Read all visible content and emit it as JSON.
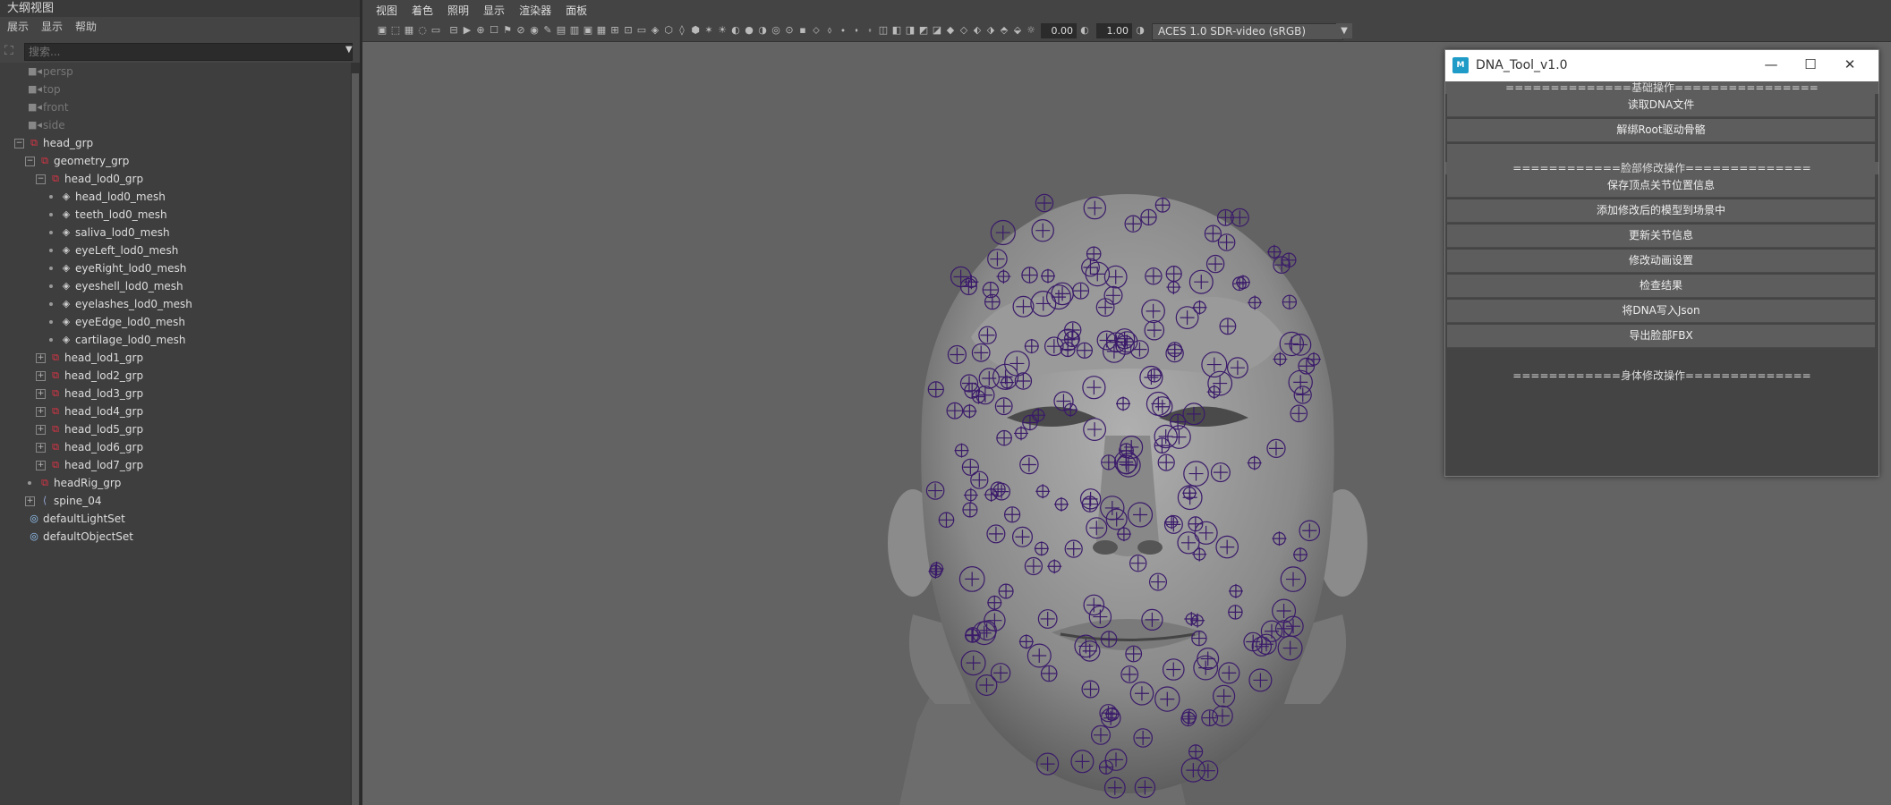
{
  "outliner": {
    "title": "大纲视图",
    "menu": [
      "展示",
      "显示",
      "帮助"
    ],
    "search_placeholder": "搜索...",
    "items": [
      {
        "label": "persp",
        "type": "camera"
      },
      {
        "label": "top",
        "type": "camera"
      },
      {
        "label": "front",
        "type": "camera"
      },
      {
        "label": "side",
        "type": "camera"
      },
      {
        "label": "head_grp",
        "type": "group"
      },
      {
        "label": "geometry_grp",
        "type": "group"
      },
      {
        "label": "head_lod0_grp",
        "type": "group"
      },
      {
        "label": "head_lod0_mesh",
        "type": "mesh"
      },
      {
        "label": "teeth_lod0_mesh",
        "type": "mesh"
      },
      {
        "label": "saliva_lod0_mesh",
        "type": "mesh"
      },
      {
        "label": "eyeLeft_lod0_mesh",
        "type": "mesh"
      },
      {
        "label": "eyeRight_lod0_mesh",
        "type": "mesh"
      },
      {
        "label": "eyeshell_lod0_mesh",
        "type": "mesh"
      },
      {
        "label": "eyelashes_lod0_mesh",
        "type": "mesh"
      },
      {
        "label": "eyeEdge_lod0_mesh",
        "type": "mesh"
      },
      {
        "label": "cartilage_lod0_mesh",
        "type": "mesh"
      },
      {
        "label": "head_lod1_grp",
        "type": "group"
      },
      {
        "label": "head_lod2_grp",
        "type": "group"
      },
      {
        "label": "head_lod3_grp",
        "type": "group"
      },
      {
        "label": "head_lod4_grp",
        "type": "group"
      },
      {
        "label": "head_lod5_grp",
        "type": "group"
      },
      {
        "label": "head_lod6_grp",
        "type": "group"
      },
      {
        "label": "head_lod7_grp",
        "type": "group"
      },
      {
        "label": "headRig_grp",
        "type": "group"
      },
      {
        "label": "spine_04",
        "type": "joint"
      },
      {
        "label": "defaultLightSet",
        "type": "set"
      },
      {
        "label": "defaultObjectSet",
        "type": "set"
      }
    ]
  },
  "viewport": {
    "menu": [
      "视图",
      "着色",
      "照明",
      "显示",
      "渲染器",
      "面板"
    ],
    "exposure": "0.00",
    "gamma": "1.00",
    "color_space": "ACES 1.0 SDR-video (sRGB)"
  },
  "dna_tool": {
    "title": "DNA_Tool_v1.0",
    "logo": "M",
    "section_basic": "==============基础操作================",
    "basic_buttons": [
      "读取DNA文件",
      "解绑Root驱动骨骼"
    ],
    "section_face": "============脸部修改操作==============",
    "face_buttons": [
      "保存顶点关节位置信息",
      "添加修改后的模型到场景中",
      "更新关节信息",
      "修改动画设置",
      "检查结果",
      "将DNA写入Json",
      "导出脸部FBX"
    ],
    "section_body": "============身体修改操作=============="
  },
  "colors": {
    "group_icon": "#dd3344",
    "wire_controls": "#3a1a6a",
    "viewport_bg": "#636363"
  }
}
